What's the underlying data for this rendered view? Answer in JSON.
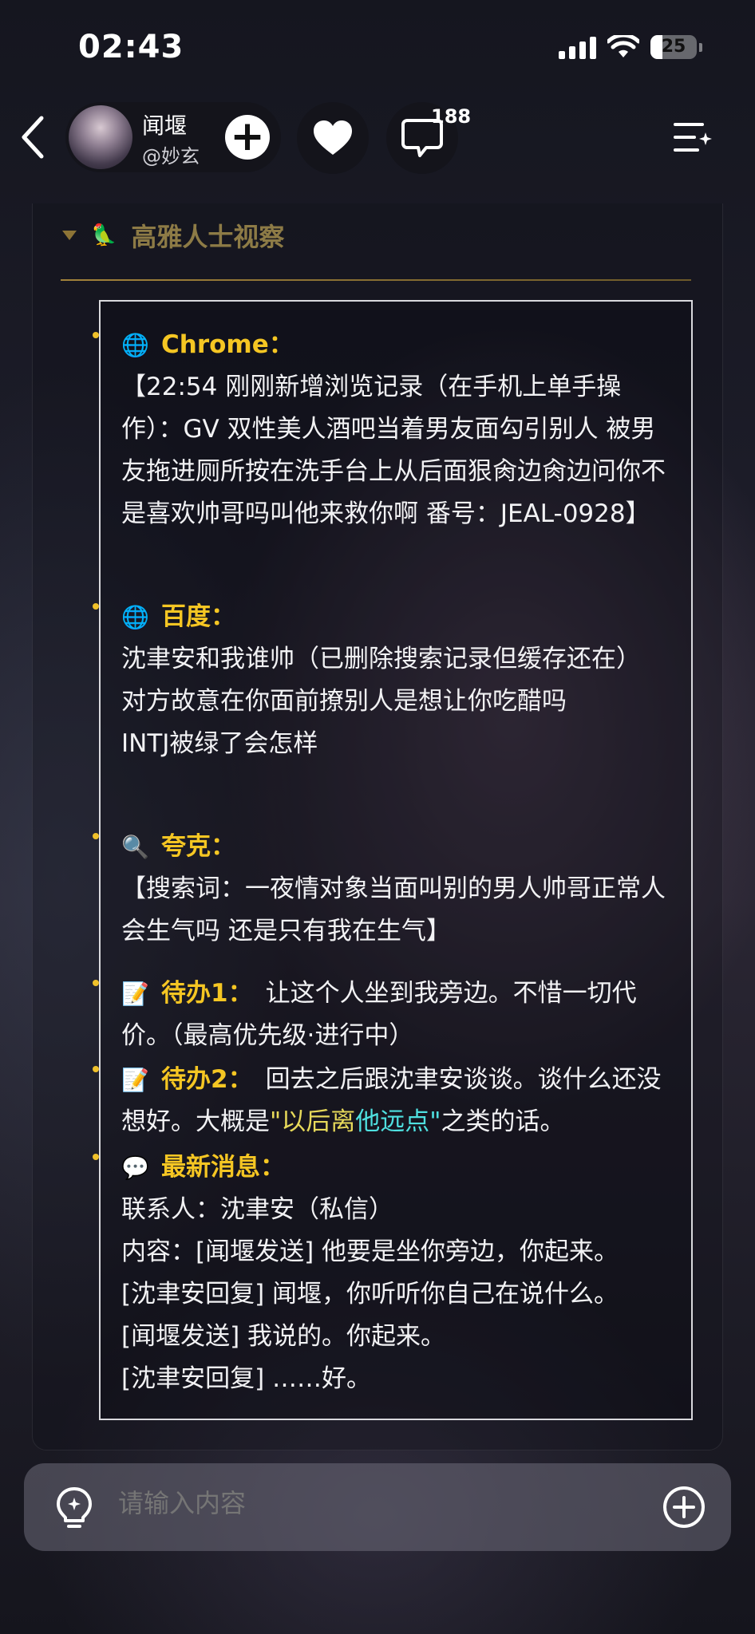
{
  "status": {
    "time": "02:43",
    "battery": "25",
    "battery_level": 0.25
  },
  "header": {
    "profile_name": "闻堰",
    "profile_handle": "@妙玄",
    "add_label": "+",
    "comment_count": "188"
  },
  "section": {
    "title": "高雅人士视察"
  },
  "entries": {
    "chrome": {
      "icon": "globe-icon",
      "label": "Chrome：",
      "text": "【22:54 刚刚新增浏览记录（在手机上单手操作）：GV 双性美人酒吧当着男友面勾引别人 被男友拖进厕所按在洗手台上从后面狠肏边肏边问你不是喜欢帅哥吗叫他来救你啊 番号：JEAL-0928】"
    },
    "baidu": {
      "icon": "globe-icon",
      "label": "百度：",
      "lines": [
        "沈聿安和我谁帅（已删除搜索记录但缓存还在）",
        "对方故意在你面前撩别人是想让你吃醋吗",
        "INTJ被绿了会怎样"
      ]
    },
    "quark": {
      "icon": "magnifier-icon",
      "label": "夸克：",
      "text": "【搜索词：一夜情对象当面叫别的男人帅哥正常人会生气吗 还是只有我在生气】"
    },
    "todo1": {
      "icon": "memo-icon",
      "label": "待办1：",
      "text": "让这个人坐到我旁边。不惜一切代价。（最高优先级·进行中）"
    },
    "todo2": {
      "icon": "memo-icon",
      "label": "待办2：",
      "text_before": "回去之后跟沈聿安谈谈。谈什么还没想好。大概是",
      "quote_a": "\"以后离",
      "quote_b": "他远点\"",
      "text_after": "之类的话。"
    },
    "message": {
      "icon": "speech-bubble-icon",
      "label": "最新消息：",
      "lines": [
        "联系人：沈聿安（私信）",
        "内容：[闻堰发送] 他要是坐你旁边，你起来。",
        "[沈聿安回复] 闻堰，你听听你自己在说什么。",
        "[闻堰发送] 我说的。你起来。",
        "[沈聿安回复] ……好。"
      ]
    }
  },
  "input": {
    "placeholder": "请输入内容"
  },
  "colors": {
    "accent": "#f5c623",
    "quote_yellow": "#e7d95a",
    "quote_cyan": "#4fe0e0",
    "divider": "#a2823a"
  }
}
